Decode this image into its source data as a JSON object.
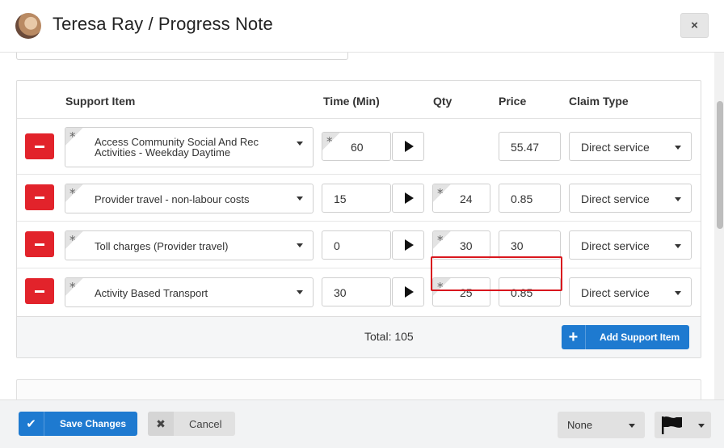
{
  "header": {
    "title": "Teresa Ray / Progress Note",
    "close_label": "×"
  },
  "table": {
    "columns": {
      "support_item": "Support Item",
      "time": "Time (Min)",
      "qty": "Qty",
      "price": "Price",
      "claim_type": "Claim Type"
    },
    "rows": [
      {
        "support_item": "Access Community Social And Rec Activities - Weekday Daytime",
        "time": "60",
        "qty": "",
        "price": "55.47",
        "claim_type": "Direct service"
      },
      {
        "support_item": "Provider travel - non-labour costs",
        "time": "15",
        "qty": "24",
        "price": "0.85",
        "claim_type": "Direct service"
      },
      {
        "support_item": "Toll charges (Provider travel)",
        "time": "0",
        "qty": "30",
        "price": "30",
        "claim_type": "Direct service"
      },
      {
        "support_item": "Activity Based Transport",
        "time": "30",
        "qty": "25",
        "price": "0.85",
        "claim_type": "Direct service"
      }
    ],
    "required_marker": "*",
    "total": "Total: 105",
    "add_button_label": "Add Support Item",
    "add_button_icon": "+"
  },
  "footer": {
    "save_label": "Save Changes",
    "save_icon": "✔",
    "cancel_label": "Cancel",
    "cancel_icon": "✖",
    "status_value": "None"
  },
  "colors": {
    "primary": "#1e7ad0",
    "danger": "#e2232b",
    "highlight": "#d9171e"
  }
}
